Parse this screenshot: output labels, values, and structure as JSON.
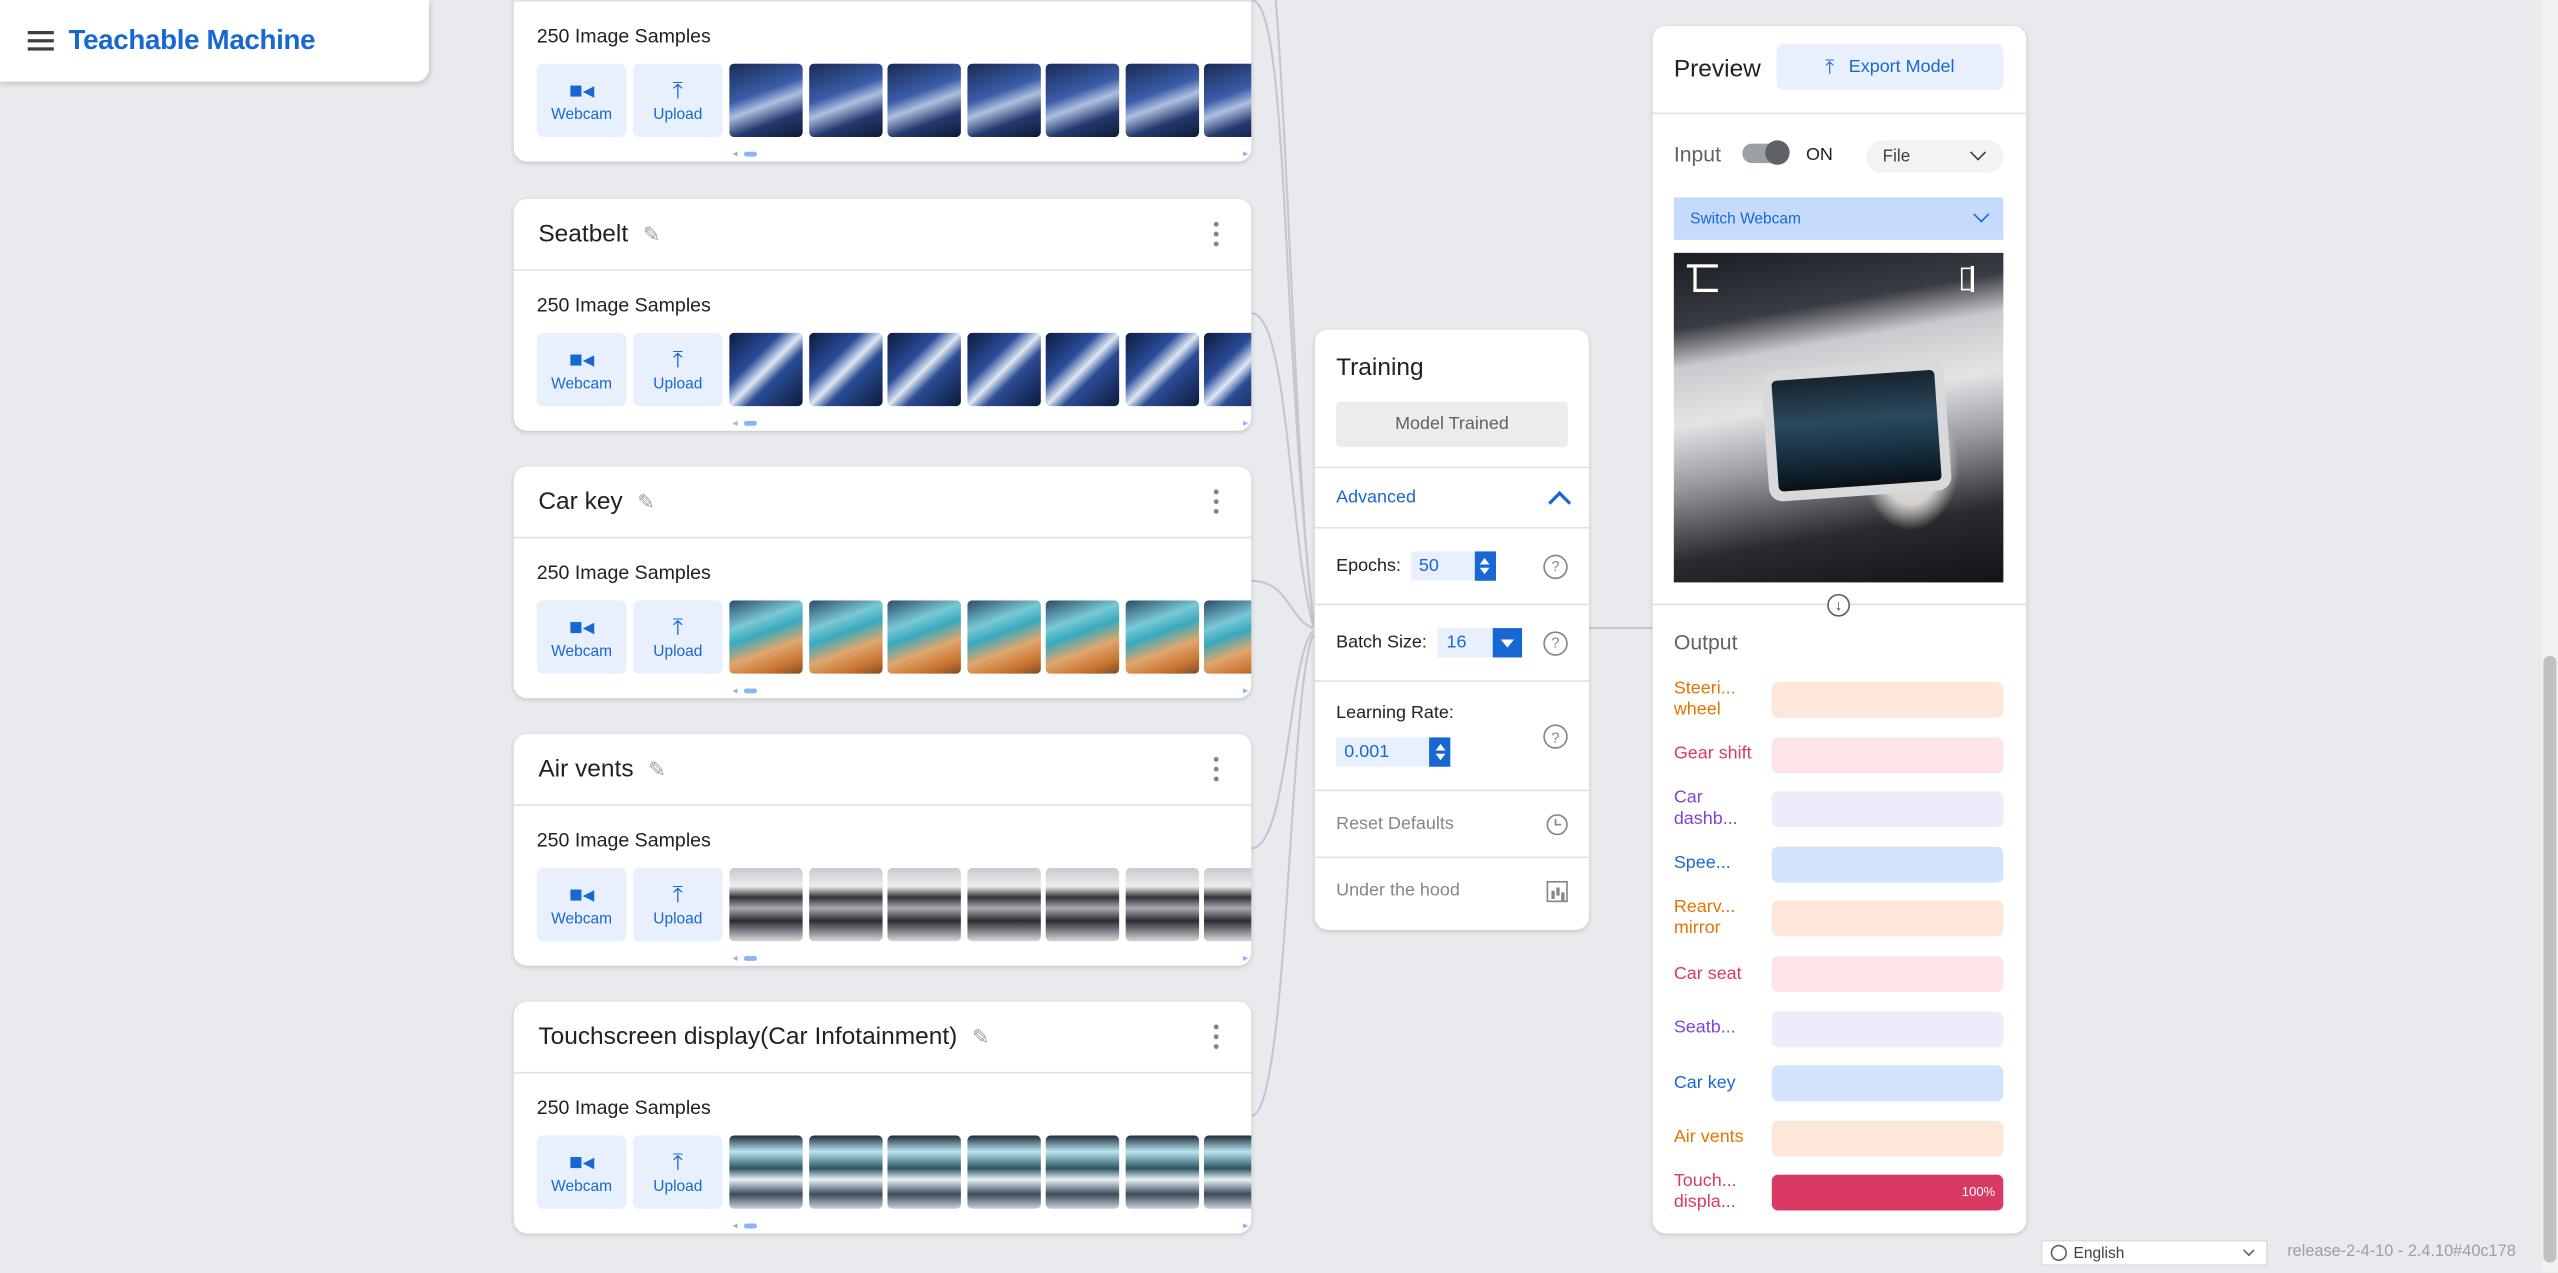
{
  "app": {
    "title": "Teachable Machine",
    "menu_icon": "menu-icon"
  },
  "classes": [
    {
      "name": "",
      "samples": "250 Image Samples",
      "thumb_style": "seat"
    },
    {
      "name": "Seatbelt",
      "samples": "250 Image Samples",
      "thumb_style": "belt"
    },
    {
      "name": "Car key",
      "samples": "250 Image Samples",
      "thumb_style": "key"
    },
    {
      "name": "Air vents",
      "samples": "250 Image Samples",
      "thumb_style": "vent"
    },
    {
      "name": "Touchscreen display(Car Infotainment)",
      "samples": "250 Image Samples",
      "thumb_style": "touch"
    }
  ],
  "source_buttons": {
    "webcam": "Webcam",
    "upload": "Upload"
  },
  "training": {
    "title": "Training",
    "status_button": "Model Trained",
    "advanced": "Advanced",
    "epochs_label": "Epochs:",
    "epochs_value": "50",
    "batch_label": "Batch Size:",
    "batch_value": "16",
    "lr_label": "Learning Rate:",
    "lr_value": "0.001",
    "reset": "Reset Defaults",
    "hood": "Under the hood",
    "help_glyph": "?"
  },
  "preview": {
    "title": "Preview",
    "export_label": "Export Model",
    "input_label": "Input",
    "toggle_state": "ON",
    "source_select": "File",
    "switch_webcam": "Switch Webcam",
    "down_arrow": "↓",
    "output_title": "Output",
    "outputs": [
      {
        "label": "Steeri... wheel",
        "color": "#e37400",
        "bg": "#fde7d9",
        "value": 0,
        "pct_text": ""
      },
      {
        "label": "Gear shift",
        "color": "#d93a63",
        "bg": "#fce4e9",
        "value": 0,
        "pct_text": ""
      },
      {
        "label": "Car dashb...",
        "color": "#8142d8",
        "bg": "#eeebfb",
        "value": 0,
        "pct_text": ""
      },
      {
        "label": "Spee...",
        "color": "#1967d2",
        "bg": "#d2e3fc",
        "value": 0,
        "pct_text": ""
      },
      {
        "label": "Rearv... mirror",
        "color": "#e37400",
        "bg": "#fde7d9",
        "value": 0,
        "pct_text": ""
      },
      {
        "label": "Car seat",
        "color": "#d93a63",
        "bg": "#fce4e9",
        "value": 0,
        "pct_text": ""
      },
      {
        "label": "Seatb...",
        "color": "#8142d8",
        "bg": "#eeebfb",
        "value": 0,
        "pct_text": ""
      },
      {
        "label": "Car key",
        "color": "#1967d2",
        "bg": "#d2e3fc",
        "value": 0,
        "pct_text": ""
      },
      {
        "label": "Air vents",
        "color": "#e37400",
        "bg": "#fde7d9",
        "value": 0,
        "pct_text": ""
      },
      {
        "label": "Touch... displa...",
        "color": "#d93a63",
        "bg": "#fce4e9",
        "value": 1,
        "pct_text": "100%"
      }
    ]
  },
  "footer": {
    "language": "English",
    "release": "release-2-4-10 - 2.4.10#40c178"
  },
  "colors": {
    "accent": "#1967d2",
    "accent_light": "#e8f0fe",
    "background": "#e8eaed"
  }
}
